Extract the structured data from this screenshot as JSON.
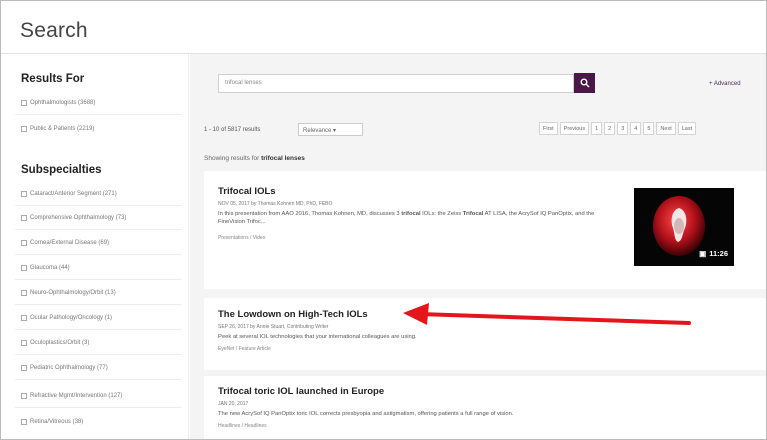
{
  "page": {
    "title": "Search"
  },
  "sidebar": {
    "results_for": {
      "heading": "Results For",
      "items": [
        {
          "label": "Ophthalmologists (3688)"
        },
        {
          "label": "Public & Patients (2219)"
        }
      ]
    },
    "subspecialties": {
      "heading": "Subspecialties",
      "items": [
        {
          "label": "Cataract/Anterior Segment (271)"
        },
        {
          "label": "Comprehensive Ophthalmology (73)"
        },
        {
          "label": "Cornea/External Disease (69)"
        },
        {
          "label": "Glaucoma (44)"
        },
        {
          "label": "Neuro-Ophthalmology/Orbit (13)"
        },
        {
          "label": "Ocular Pathology/Oncology (1)"
        },
        {
          "label": "Oculoplastics/Orbit (3)"
        },
        {
          "label": "Pediatric Ophthalmology (77)"
        },
        {
          "label": "Refractive Mgmt/Intervention (127)"
        },
        {
          "label": "Retina/Vitreous (38)"
        }
      ]
    }
  },
  "search": {
    "value": "trifocal lenses",
    "button_icon": "search-icon",
    "advanced_label": "+ Advanced"
  },
  "toolbar": {
    "results_count": "1 - 10 of 5817 results",
    "sort_value": "Relevance",
    "pager": [
      "First",
      "Previous",
      "1",
      "2",
      "3",
      "4",
      "5",
      "Next",
      "Last"
    ]
  },
  "showing": {
    "prefix": "Showing results for",
    "query": "trifocal lenses"
  },
  "results": [
    {
      "title": "Trifocal IOLs",
      "meta": "NOV 05, 2017 by Thomas Kohnen MD, PhD, FEBO",
      "desc_parts": [
        "In this presentation from AAO 2016, Thomas Kohnen, MD, discusses 3 ",
        "trifocal",
        " IOLs: the Zeiss ",
        "Trifocal",
        " AT LISA, the AcrySof IQ PanOptix, and the FineVision Trifoc..."
      ],
      "tag": "Presentations / Video",
      "duration": "11:26"
    },
    {
      "title": "The Lowdown on High-Tech IOLs",
      "meta": "SEP 26, 2017 by Annie Stuart, Contributing Writer",
      "desc": "Peek at several IOL technologies that your international colleagues are using.",
      "tag": "EyeNet / Feature Article"
    },
    {
      "title": "Trifocal toric IOL launched in Europe",
      "meta": "JAN 20, 2017",
      "desc": "The new AcrySof IQ PanOptix toric IOL corrects presbyopia and astigmatism, offering patients a full range of vision.",
      "tag": "Headlines / Headlines"
    }
  ],
  "colors": {
    "accent": "#4a1848",
    "arrow": "#e4151b"
  }
}
